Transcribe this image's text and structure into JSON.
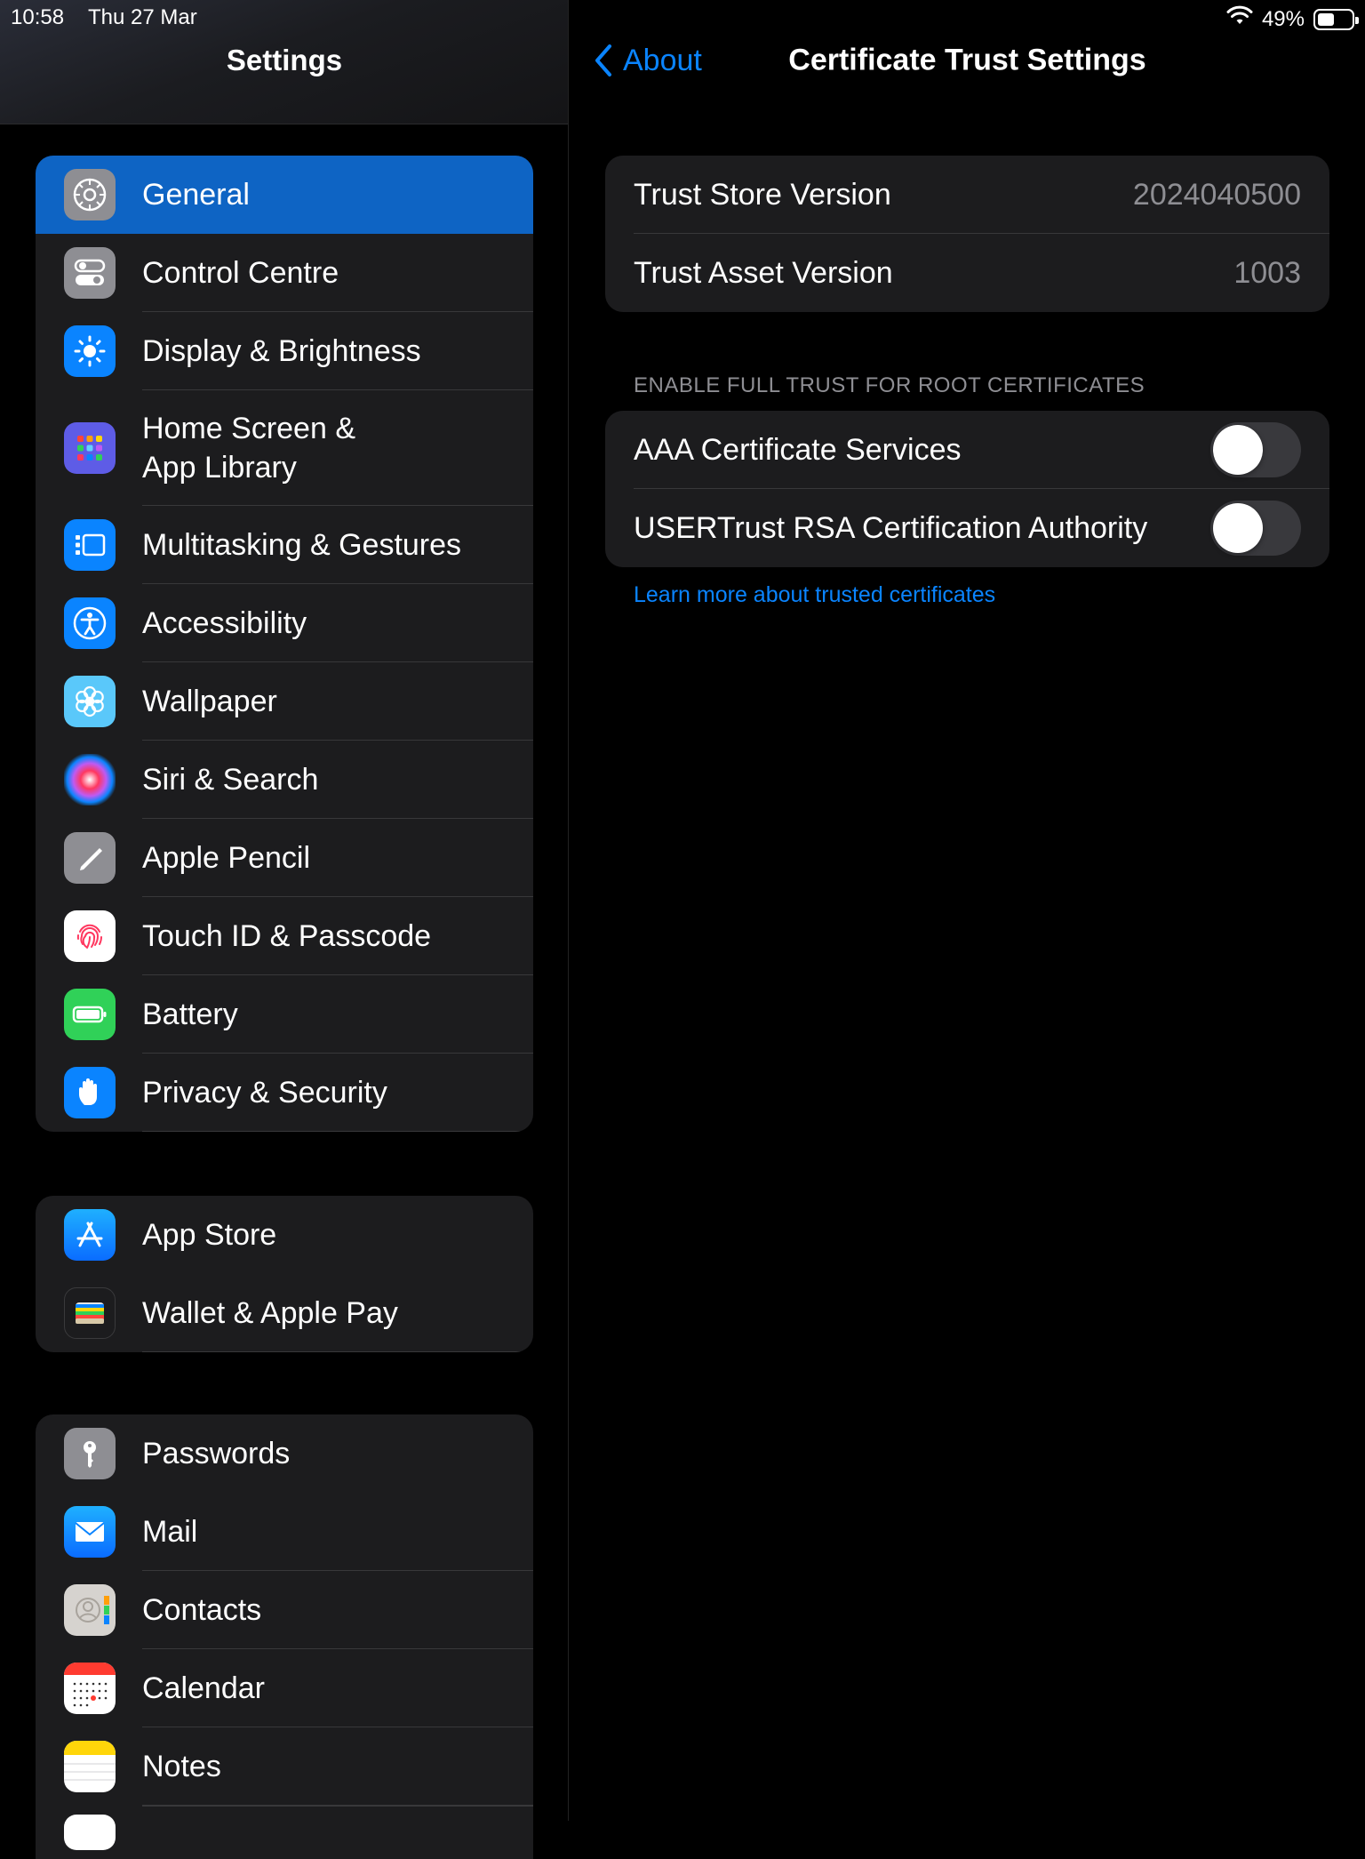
{
  "status_bar": {
    "time": "10:58",
    "date": "Thu 27 Mar",
    "battery_percent": "49%",
    "battery_level": 0.49
  },
  "sidebar": {
    "title": "Settings",
    "groups": [
      {
        "items": [
          {
            "label": "General",
            "icon": "gear-icon",
            "color": "#8e8e93",
            "selected": true
          },
          {
            "label": "Control Centre",
            "icon": "switches-icon",
            "color": "#8e8e93"
          },
          {
            "label": "Display & Brightness",
            "icon": "sun-icon",
            "color": "#0a84ff"
          },
          {
            "label_line1": "Home Screen &",
            "label_line2": "App Library",
            "icon": "app-grid-icon",
            "color": "#5e5ce6"
          },
          {
            "label": "Multitasking & Gestures",
            "icon": "multitasking-icon",
            "color": "#0a84ff"
          },
          {
            "label": "Accessibility",
            "icon": "accessibility-icon",
            "color": "#0a84ff"
          },
          {
            "label": "Wallpaper",
            "icon": "flower-icon",
            "color": "#5ac8fa"
          },
          {
            "label": "Siri & Search",
            "icon": "siri-icon",
            "color": "#1c1c1e"
          },
          {
            "label": "Apple Pencil",
            "icon": "pencil-icon",
            "color": "#8e8e93"
          },
          {
            "label": "Touch ID & Passcode",
            "icon": "fingerprint-icon",
            "color": "#ffffff"
          },
          {
            "label": "Battery",
            "icon": "battery-icon",
            "color": "#30d158"
          },
          {
            "label": "Privacy & Security",
            "icon": "hand-icon",
            "color": "#0a84ff"
          }
        ]
      },
      {
        "items": [
          {
            "label": "App Store",
            "icon": "app-store-icon",
            "color": "#0a84ff"
          },
          {
            "label": "Wallet & Apple Pay",
            "icon": "wallet-icon",
            "color": "#1c1c1e"
          }
        ]
      },
      {
        "items": [
          {
            "label": "Passwords",
            "icon": "key-icon",
            "color": "#8e8e93"
          },
          {
            "label": "Mail",
            "icon": "mail-icon",
            "color": "#0a84ff"
          },
          {
            "label": "Contacts",
            "icon": "contacts-icon",
            "color": "#d6d3cf"
          },
          {
            "label": "Calendar",
            "icon": "calendar-icon",
            "color": "#ffffff"
          },
          {
            "label": "Notes",
            "icon": "notes-icon",
            "color": "#ffd60a"
          }
        ]
      }
    ]
  },
  "detail": {
    "back_label": "About",
    "title": "Certificate Trust Settings",
    "versions": [
      {
        "label": "Trust Store Version",
        "value": "2024040500"
      },
      {
        "label": "Trust Asset Version",
        "value": "1003"
      }
    ],
    "section_header": "ENABLE FULL TRUST FOR ROOT CERTIFICATES",
    "certificates": [
      {
        "label": "AAA Certificate Services",
        "enabled": false
      },
      {
        "label": "USERTrust RSA Certification Authority",
        "enabled": false
      }
    ],
    "learn_more": "Learn more about trusted certificates"
  }
}
